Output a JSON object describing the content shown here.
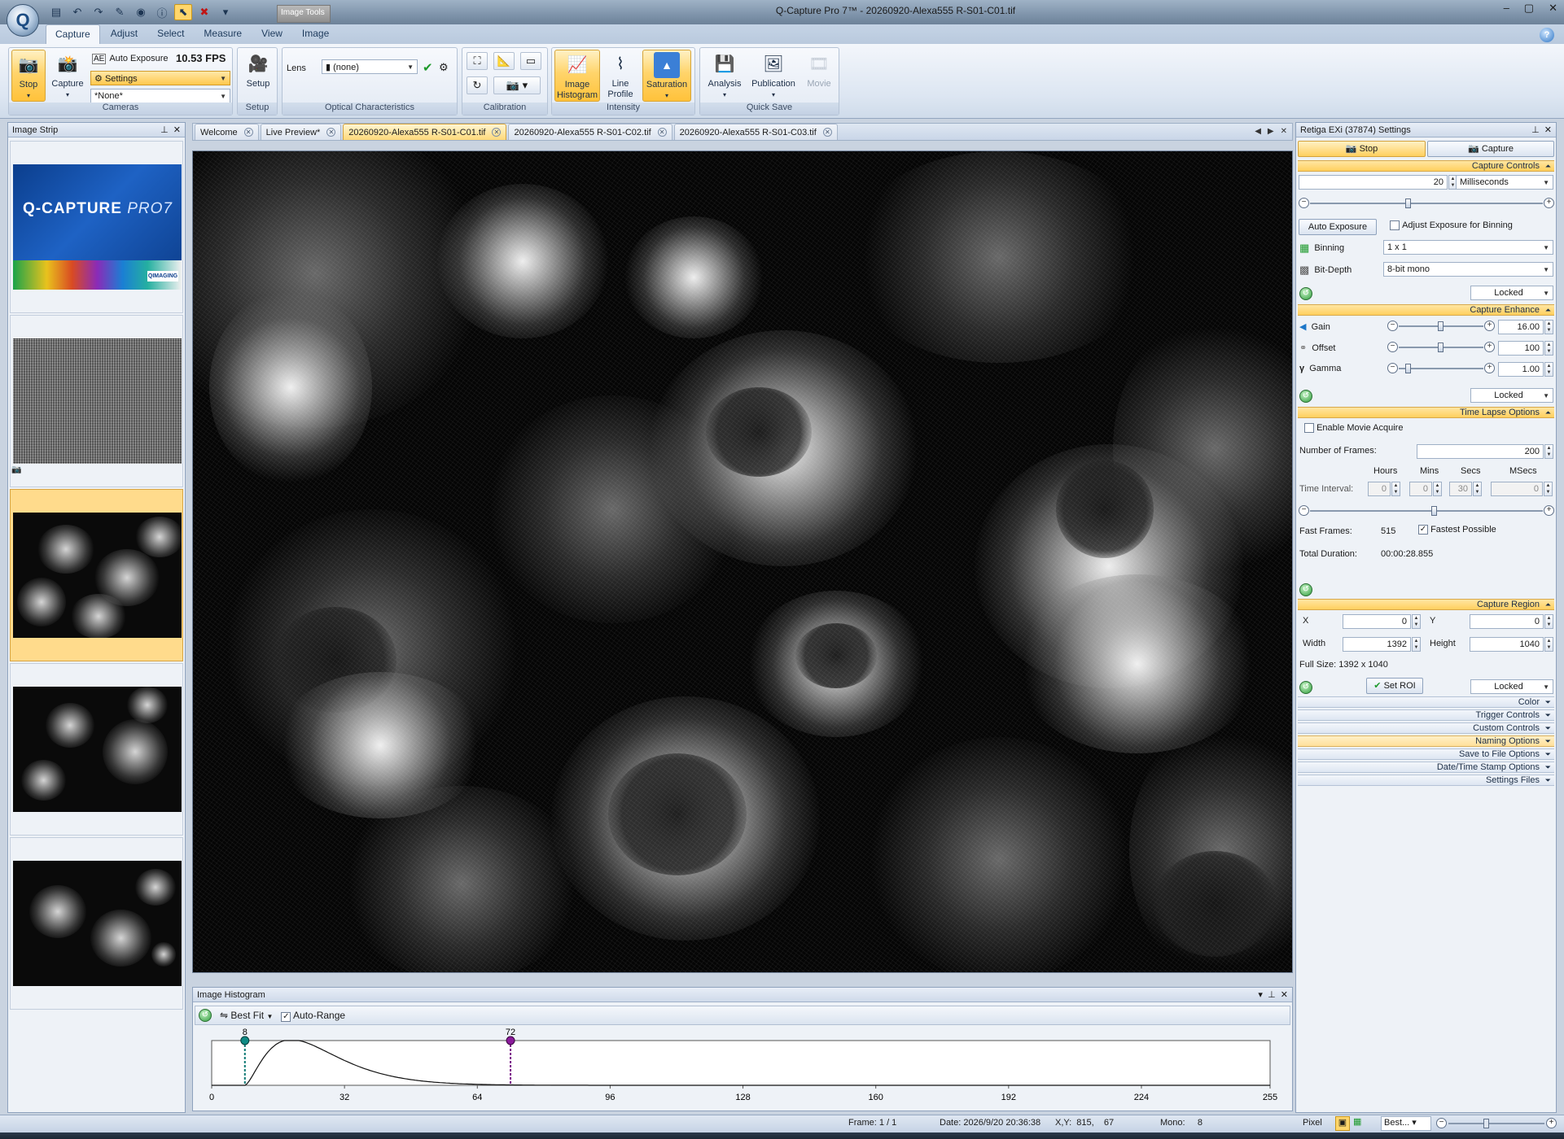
{
  "window": {
    "title": "Q-Capture Pro 7™ - 20260920-Alexa555 R-S01-C01.tif",
    "context_tab": "Image Tools",
    "controls": [
      "–",
      "▢",
      "✕"
    ]
  },
  "ribbon": {
    "tabs": [
      "Capture",
      "Adjust",
      "Select",
      "Measure",
      "View",
      "Image"
    ],
    "active_tab": "Capture",
    "cameras": {
      "stop_label": "Stop",
      "capture_label": "Capture",
      "auto_exposure_label": "Auto Exposure",
      "fps": "10.53 FPS",
      "settings_label": "Settings",
      "preset_value": "*None*",
      "group_label": "Cameras"
    },
    "setup": {
      "button_label": "Setup",
      "group_label": "Setup"
    },
    "optical": {
      "lens_label": "Lens",
      "lens_value": "(none)",
      "group_label": "Optical Characteristics"
    },
    "calibration": {
      "group_label": "Calibration"
    },
    "intensity": {
      "histogram_label": "Image Histogram",
      "line_profile_label": "Line Profile",
      "saturation_label": "Saturation",
      "group_label": "Intensity"
    },
    "quicksave": {
      "analysis_label": "Analysis",
      "publication_label": "Publication",
      "movie_label": "Movie",
      "group_label": "Quick Save"
    }
  },
  "image_strip": {
    "title": "Image Strip",
    "thumbs": [
      {
        "kind": "splash",
        "logo": "Q-CAPTURE",
        "logo_suffix": "PRO7",
        "badge": "QIMAGING"
      },
      {
        "kind": "noise"
      },
      {
        "kind": "micro",
        "selected": true
      },
      {
        "kind": "micro"
      },
      {
        "kind": "micro"
      }
    ]
  },
  "doc_tabs": [
    {
      "label": "Welcome",
      "active": false
    },
    {
      "label": "Live Preview*",
      "active": false
    },
    {
      "label": "20260920-Alexa555 R-S01-C01.tif",
      "active": true
    },
    {
      "label": "20260920-Alexa555 R-S01-C02.tif",
      "active": false
    },
    {
      "label": "20260920-Alexa555 R-S01-C03.tif",
      "active": false
    }
  ],
  "histogram": {
    "title": "Image Histogram",
    "fit_label": "Best Fit",
    "auto_range_label": "Auto-Range",
    "auto_range_checked": true,
    "low_marker": "8",
    "high_marker": "72",
    "low_value": 8,
    "high_value": 72,
    "x_ticks": [
      "0",
      "32",
      "64",
      "96",
      "128",
      "160",
      "192",
      "224",
      "255"
    ]
  },
  "settings_panel": {
    "title": "Retiga EXi (37874) Settings",
    "stop_tab": "Stop",
    "capture_tab": "Capture",
    "capture_controls": {
      "header": "Capture Controls",
      "exposure_value": "20",
      "exposure_unit": "Milliseconds",
      "auto_exposure_btn": "Auto Exposure",
      "adjust_binning_label": "Adjust Exposure for Binning",
      "binning_label": "Binning",
      "binning_value": "1 x 1",
      "bitdepth_label": "Bit-Depth",
      "bitdepth_value": "8-bit mono",
      "locked": "Locked"
    },
    "capture_enhance": {
      "header": "Capture Enhance",
      "gain_label": "Gain",
      "gain_value": "16.00",
      "offset_label": "Offset",
      "offset_value": "100",
      "gamma_label": "Gamma",
      "gamma_value": "1.00",
      "locked": "Locked"
    },
    "time_lapse": {
      "header": "Time Lapse Options",
      "enable_movie_label": "Enable Movie Acquire",
      "frames_label": "Number of Frames:",
      "frames_value": "200",
      "col_hours": "Hours",
      "col_mins": "Mins",
      "col_secs": "Secs",
      "col_msecs": "MSecs",
      "interval_label": "Time Interval:",
      "hours": "0",
      "mins": "0",
      "secs": "30",
      "msecs": "0",
      "fast_frames_label": "Fast Frames:",
      "fast_frames_value": "515",
      "fastest_label": "Fastest Possible",
      "total_duration_label": "Total Duration:",
      "total_duration_value": "00:00:28.855"
    },
    "capture_region": {
      "header": "Capture Region",
      "x_label": "X",
      "x_value": "0",
      "y_label": "Y",
      "y_value": "0",
      "width_label": "Width",
      "width_value": "1392",
      "height_label": "Height",
      "height_value": "1040",
      "full_size": "Full Size: 1392 x 1040",
      "set_roi_btn": "Set ROI",
      "locked": "Locked"
    },
    "collapsed_sections": [
      "Color",
      "Trigger Controls",
      "Custom Controls",
      "Naming Options",
      "Save to File Options",
      "Date/Time Stamp Options",
      "Settings Files"
    ]
  },
  "status_bar": {
    "frame": "Frame: 1 / 1",
    "date": "Date: 2026/9/20 20:36:38",
    "xy": "X,Y:  815,    67",
    "mono": "Mono:     8",
    "pixel": "Pixel",
    "zoom": "Best..."
  }
}
